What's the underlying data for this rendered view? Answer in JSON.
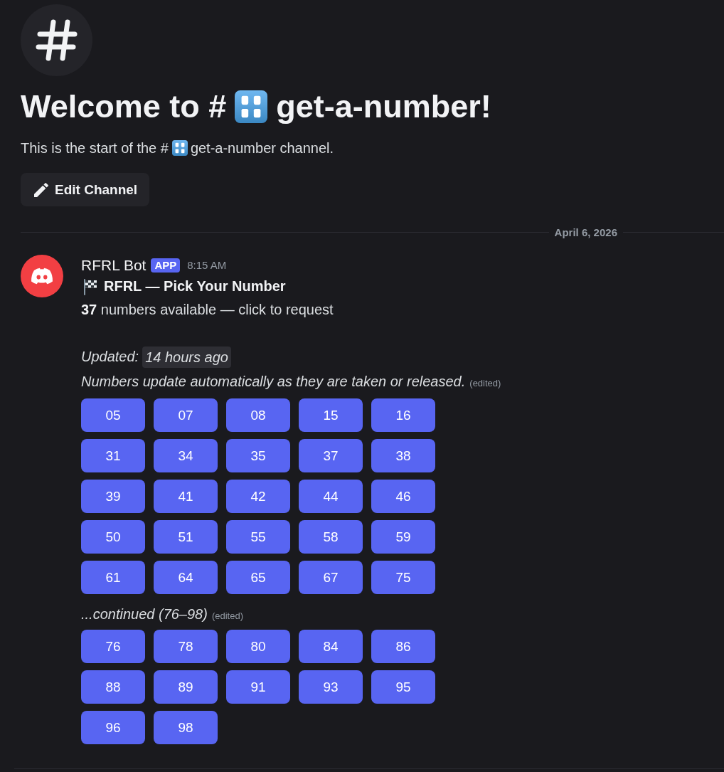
{
  "channel_header": {
    "title_before": "Welcome to #",
    "title_after": "get-a-number!",
    "intro_before": "This is the start of the #",
    "intro_after": "get-a-number channel.",
    "edit_button": "Edit Channel"
  },
  "date_divider": "April 6, 2026",
  "message": {
    "author": "RFRL Bot",
    "badge": "APP",
    "time": "8:15 AM",
    "title": "RFRL — Pick Your Number",
    "summary": "**37** numbers available — click to request",
    "updated_label": "Updated:",
    "updated_time": "14 hours ago",
    "note": "Numbers update automatically as they are taken or released.",
    "note_edited": "(edited)",
    "number_buttons": [
      "05",
      "07",
      "08",
      "15",
      "16",
      "31",
      "34",
      "35",
      "37",
      "38",
      "39",
      "41",
      "42",
      "44",
      "46",
      "50",
      "51",
      "55",
      "58",
      "59",
      "61",
      "64",
      "65",
      "67",
      "75"
    ],
    "continued": "...continued (76–98)",
    "continued_edited": "(edited)",
    "more_number_buttons": [
      "76",
      "78",
      "80",
      "84",
      "86",
      "88",
      "89",
      "91",
      "93",
      "95",
      "96",
      "98"
    ]
  }
}
